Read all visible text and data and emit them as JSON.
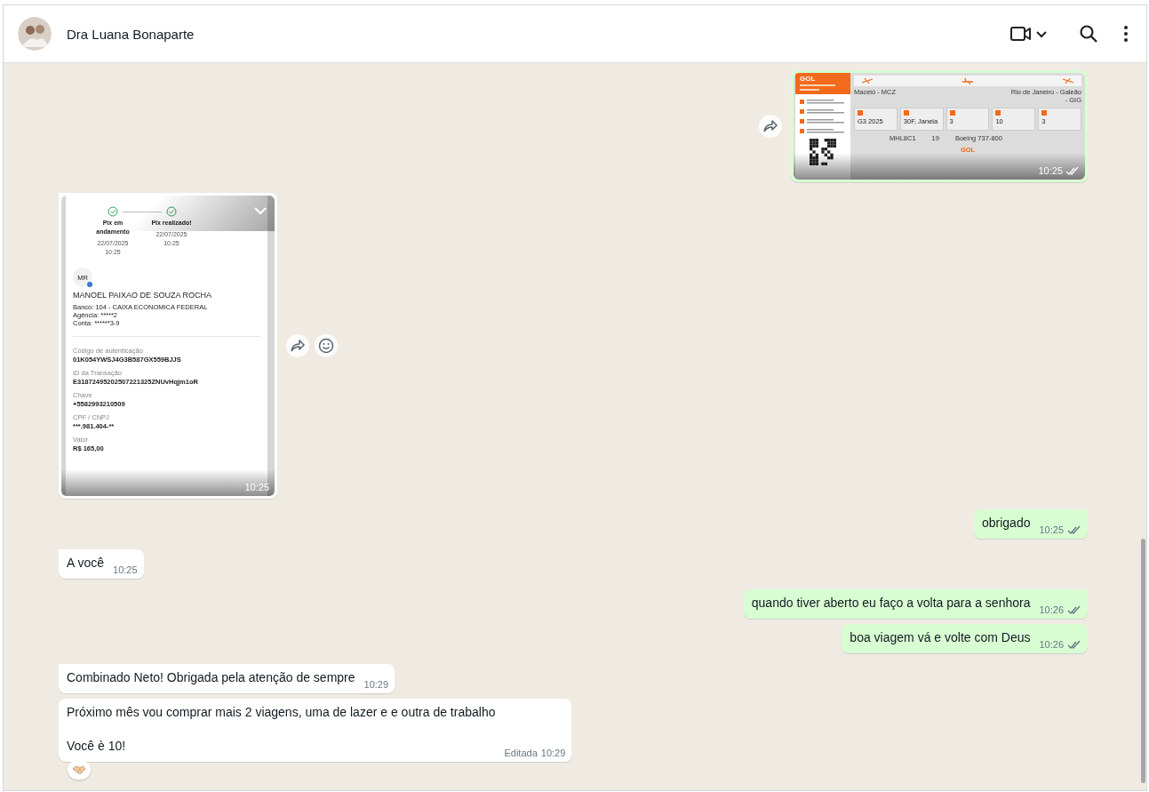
{
  "header": {
    "contact_name": "Dra Luana Bonaparte"
  },
  "messages": [
    {
      "kind": "boarding-pass",
      "outgoing": true,
      "tail": false,
      "time": "10:25",
      "read": false,
      "show_forward": true,
      "pass": {
        "airline": "GOL",
        "origin": "Maceió - MCZ",
        "destination": "Rio de Janeiro - Galeão - GIG",
        "fields": [
          "G3 2025",
          "30F, Janela",
          "3",
          "10",
          "3"
        ],
        "details": [
          "MHL8C1",
          "19",
          "Boeing 737-800"
        ],
        "footer_brand": "GOL"
      }
    },
    {
      "kind": "receipt",
      "outgoing": false,
      "tail": true,
      "time": "10:25",
      "show_forward": true,
      "show_react": true,
      "receipt": {
        "steps": [
          {
            "label": "Pix em andamento",
            "date": "22/07/2025",
            "time": "10:25"
          },
          {
            "label": "Pix realizado!",
            "date": "22/07/2025",
            "time": "10:25"
          }
        ],
        "initials": "MR",
        "recipient": "MANOEL PAIXAO DE SOUZA ROCHA",
        "bank_lines": [
          "Banco: 104 - CAIXA ECONOMICA FEDERAL",
          "Agência: *****2",
          "Conta: ******3-9"
        ],
        "fields": [
          {
            "label": "Código de autenticação",
            "value": "01K054YWSJ4G3B587GX559BJJS"
          },
          {
            "label": "ID da Transação",
            "value": "E31872495202507221325ZNUvHqjm1oR"
          },
          {
            "label": "Chave",
            "value": "+5582993210509"
          },
          {
            "label": "CPF / CNPJ",
            "value": "***.981.404-**"
          },
          {
            "label": "Valor",
            "value": "R$ 165,00"
          }
        ]
      }
    },
    {
      "kind": "text",
      "outgoing": true,
      "tail": true,
      "text": "obrigado",
      "time": "10:25",
      "read": false
    },
    {
      "kind": "text",
      "outgoing": false,
      "tail": true,
      "text": "A você",
      "time": "10:25"
    },
    {
      "kind": "text",
      "outgoing": true,
      "tail": true,
      "text": "quando tiver aberto eu faço a volta para a senhora",
      "time": "10:26",
      "read": false
    },
    {
      "kind": "text",
      "outgoing": true,
      "tail": false,
      "text": "boa viagem vá e volte com Deus",
      "time": "10:26",
      "read": false
    },
    {
      "kind": "text",
      "outgoing": false,
      "tail": true,
      "text": "Combinado Neto! Obrigada pela atenção de sempre",
      "time": "10:29"
    },
    {
      "kind": "text",
      "outgoing": false,
      "tail": false,
      "text": "Próximo mês vou comprar mais 2 viagens, uma de lazer e e outra de trabalho\n\nVocê è 10!",
      "time": "10:29",
      "edited_label": "Editada",
      "has_reaction": true
    }
  ]
}
